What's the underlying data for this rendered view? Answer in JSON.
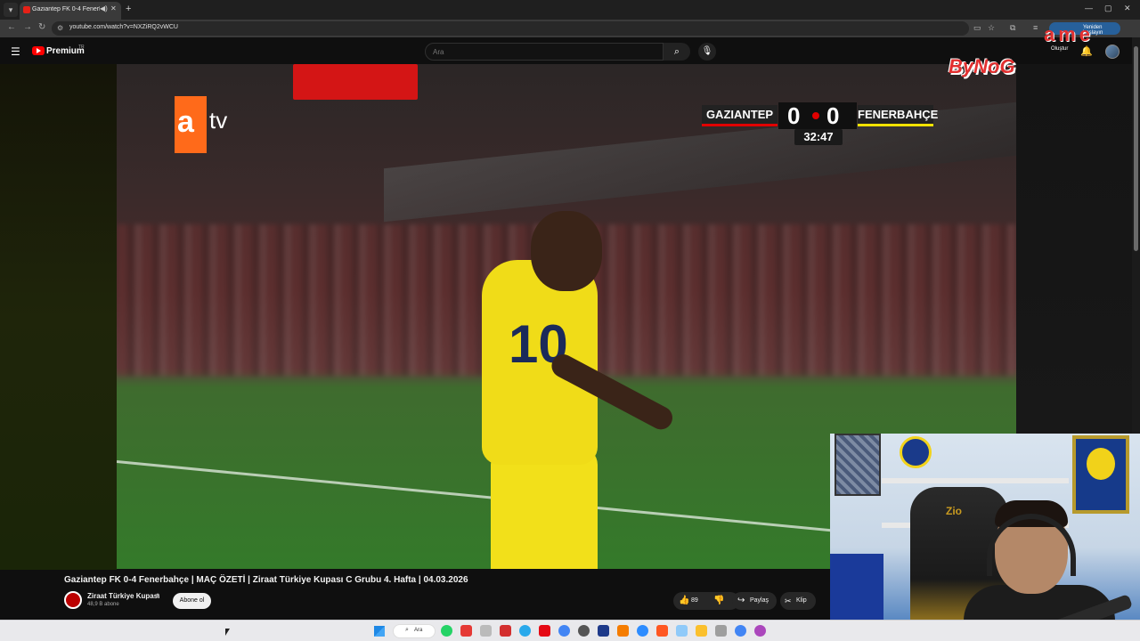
{
  "browser": {
    "tab_title": "Gaziantep FK 0-4 Fenerbahçe",
    "url": "youtube.com/watch?v=NXZiRQ2vWCU",
    "profile_chip": "Yeniden başlayın"
  },
  "youtube": {
    "logo_text": "Premium",
    "region": "TR",
    "search_placeholder": "Ara",
    "create_label": "Oluştur"
  },
  "broadcast": {
    "channel_logo_a": "a",
    "channel_logo_tv": "tv",
    "home_team": "GAZIANTEP",
    "home_score": "0",
    "away_score": "0",
    "away_team": "FENERBAHÇE",
    "match_clock": "32:47",
    "player_number": "10"
  },
  "overlay": {
    "logo_main": "ByNoG",
    "logo_ame": "ame",
    "chair_brand": "Zio"
  },
  "video_info": {
    "title": "Gaziantep FK 0-4 Fenerbahçe | MAÇ ÖZETİ | Ziraat Türkiye Kupası C Grubu 4. Hafta | 04.03.2026",
    "channel_name": "Ziraat Türkiye Kupası",
    "subscribers": "48,9 B abone",
    "subscribe_label": "Abone ol",
    "like_count": "89",
    "share_label": "Paylaş",
    "clip_label": "Klip"
  },
  "taskbar": {
    "search_label": "Ara"
  },
  "colors": {
    "youtube_red": "#ff0000",
    "home_team_color": "#e10000",
    "away_team_color": "#f2e200",
    "atv_orange": "#ff6a1a"
  }
}
